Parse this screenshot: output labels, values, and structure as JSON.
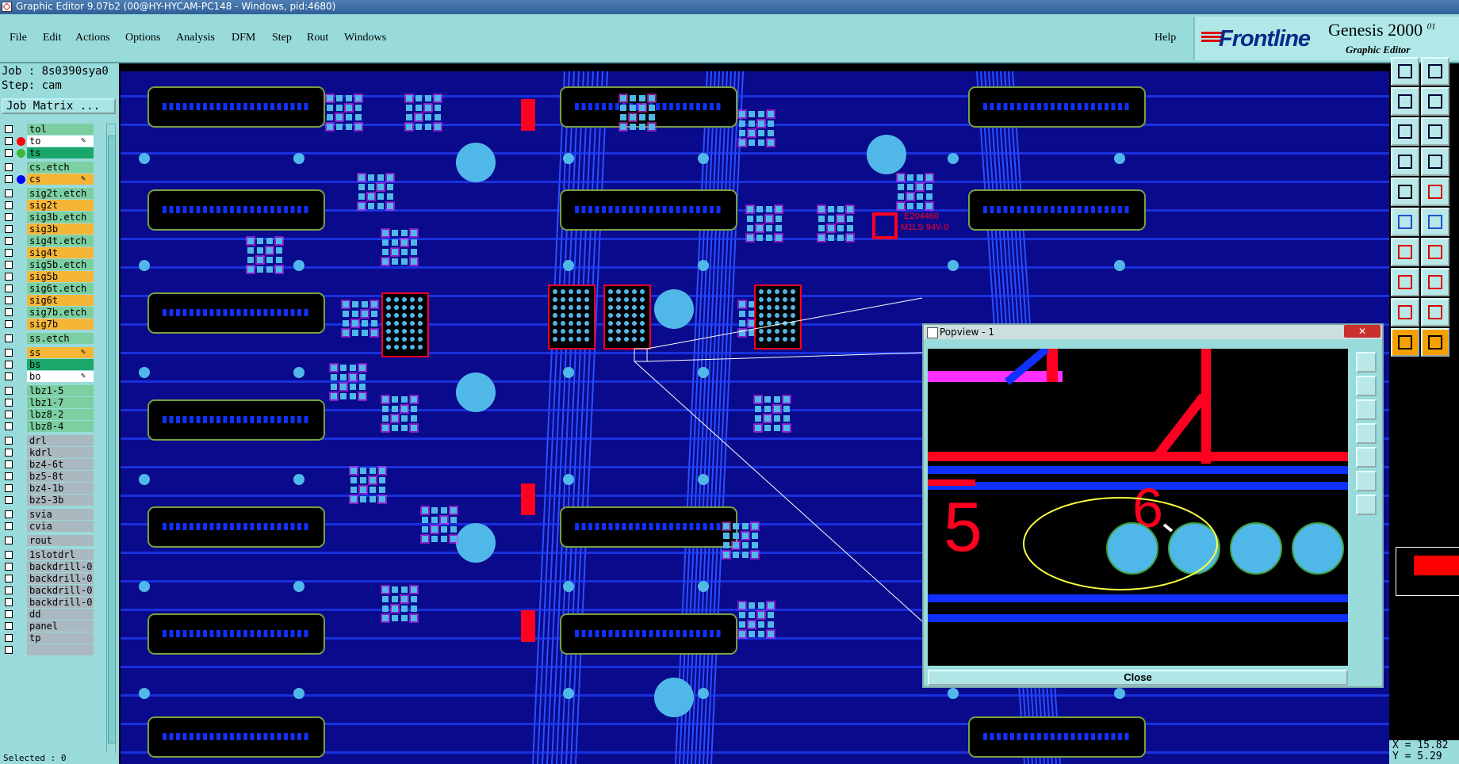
{
  "window": {
    "title": "Graphic Editor 9.07b2 (00@HY-HYCAM-PC148 - Windows, pid:4680)"
  },
  "menu": {
    "items": [
      "File",
      "Edit",
      "Actions",
      "Options",
      "Analysis",
      "DFM",
      "Step",
      "Rout",
      "Windows"
    ],
    "help": "Help"
  },
  "brand": {
    "logo": "Frontline",
    "product": "Genesis 2000",
    "superscript": "01",
    "subtitle": "Graphic Editor"
  },
  "job": {
    "job_line": "Job : 8s0390sya0",
    "step_line": "Step: cam",
    "matrix_button": "Job Matrix ..."
  },
  "layers": [
    {
      "name": "tol",
      "color": "#7ccfa0",
      "dot": null
    },
    {
      "name": "to",
      "color": "#ffffff",
      "dot": "#ff0000",
      "write": true
    },
    {
      "name": "ts",
      "color": "#1aa86a",
      "dot": "#3ab83a"
    },
    {
      "name": "cs.etch",
      "color": "#7ccfa0",
      "dot": null
    },
    {
      "name": "cs",
      "color": "#f5b638",
      "dot": "#0000ff",
      "write": true
    },
    {
      "name": "sig2t.etch",
      "color": "#7ccfa0",
      "dot": null
    },
    {
      "name": "sig2t",
      "color": "#f5b638",
      "dot": null
    },
    {
      "name": "sig3b.etch",
      "color": "#7ccfa0",
      "dot": null
    },
    {
      "name": "sig3b",
      "color": "#f5b638",
      "dot": null
    },
    {
      "name": "sig4t.etch",
      "color": "#7ccfa0",
      "dot": null
    },
    {
      "name": "sig4t",
      "color": "#f5b638",
      "dot": null
    },
    {
      "name": "sig5b.etch",
      "color": "#7ccfa0",
      "dot": null
    },
    {
      "name": "sig5b",
      "color": "#f5b638",
      "dot": null
    },
    {
      "name": "sig6t.etch",
      "color": "#7ccfa0",
      "dot": null
    },
    {
      "name": "sig6t",
      "color": "#f5b638",
      "dot": null
    },
    {
      "name": "sig7b.etch",
      "color": "#7ccfa0",
      "dot": null
    },
    {
      "name": "sig7b",
      "color": "#f5b638",
      "dot": null
    },
    {
      "name": "ss.etch",
      "color": "#7ccfa0",
      "dot": null
    },
    {
      "name": "ss",
      "color": "#f5b638",
      "dot": null,
      "write": true
    },
    {
      "name": "bs",
      "color": "#1aa86a",
      "dot": null
    },
    {
      "name": "bo",
      "color": "#ffffff",
      "dot": null,
      "write": true
    },
    {
      "name": "lbz1-5",
      "color": "#7ccfa0",
      "dot": null
    },
    {
      "name": "lbz1-7",
      "color": "#7ccfa0",
      "dot": null
    },
    {
      "name": "lbz8-2",
      "color": "#7ccfa0",
      "dot": null
    },
    {
      "name": "lbz8-4",
      "color": "#7ccfa0",
      "dot": null
    },
    {
      "name": "drl",
      "color": "#aab8c0",
      "dot": null
    },
    {
      "name": "kdrl",
      "color": "#aab8c0",
      "dot": null
    },
    {
      "name": "bz4-6t",
      "color": "#aab8c0",
      "dot": null
    },
    {
      "name": "bz5-8t",
      "color": "#aab8c0",
      "dot": null
    },
    {
      "name": "bz4-1b",
      "color": "#aab8c0",
      "dot": null
    },
    {
      "name": "bz5-3b",
      "color": "#aab8c0",
      "dot": null
    },
    {
      "name": "svia",
      "color": "#aab8c0",
      "dot": null
    },
    {
      "name": "cvia",
      "color": "#aab8c0",
      "dot": null
    },
    {
      "name": "rout",
      "color": "#aab8c0",
      "dot": null
    },
    {
      "name": "1slotdrl",
      "color": "#aab8c0",
      "dot": null
    },
    {
      "name": "backdrill-0",
      "color": "#aab8c0",
      "dot": null
    },
    {
      "name": "backdrill-0",
      "color": "#aab8c0",
      "dot": null
    },
    {
      "name": "backdrill-0",
      "color": "#aab8c0",
      "dot": null
    },
    {
      "name": "backdrill-0",
      "color": "#aab8c0",
      "dot": null
    },
    {
      "name": "dd",
      "color": "#aab8c0",
      "dot": null
    },
    {
      "name": "panel",
      "color": "#aab8c0",
      "dot": null
    },
    {
      "name": "tp",
      "color": "#aab8c0",
      "dot": null
    },
    {
      "name": "",
      "color": "#aab8c0",
      "dot": null
    }
  ],
  "status": {
    "selected": "Selected : 0",
    "x": "X = 15.82",
    "y": "Y = 5.29"
  },
  "popview": {
    "title": "Popview - 1",
    "close_button": "Close",
    "labels": [
      "5",
      "6"
    ]
  },
  "board": {
    "markings": [
      "E204460",
      "M1LS 94V-0"
    ]
  },
  "colors": {
    "board_fill": "#0a0a8c",
    "trace_blue": "#1030ff",
    "pad_cyan": "#50b8e8",
    "silk_red": "#ff0020",
    "menu_bg": "#99dbdb"
  }
}
